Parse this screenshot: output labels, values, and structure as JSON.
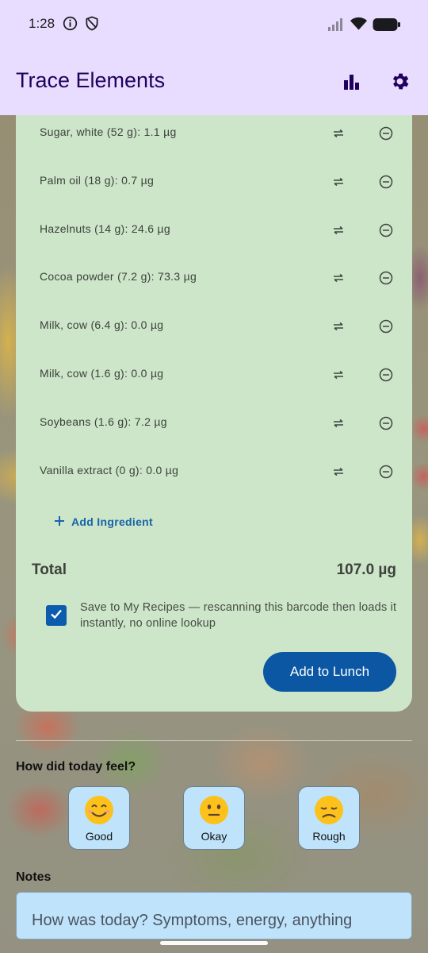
{
  "status_bar": {
    "time": "1:28"
  },
  "app_bar": {
    "title": "Trace Elements",
    "icons": [
      "bar-chart-icon",
      "settings-gear-icon"
    ]
  },
  "ingredients": [
    {
      "label": "Sugar, white (52 g): 1.1 µg"
    },
    {
      "label": "Palm oil (18 g): 0.7 µg"
    },
    {
      "label": "Hazelnuts (14 g): 24.6 µg"
    },
    {
      "label": "Cocoa powder (7.2 g): 73.3 µg"
    },
    {
      "label": "Milk, cow (6.4 g): 0.0 µg"
    },
    {
      "label": "Milk, cow (1.6 g): 0.0 µg"
    },
    {
      "label": "Soybeans (1.6 g): 7.2 µg"
    },
    {
      "label": "Vanilla extract (0 g): 0.0 µg"
    }
  ],
  "add_ingredient_label": "Add Ingredient",
  "total": {
    "label": "Total",
    "value": "107.0 µg"
  },
  "save_option": {
    "checked": true,
    "text": "Save to My Recipes — rescanning this barcode then loads it instantly, no online lookup"
  },
  "add_button_label": "Add to Lunch",
  "feel": {
    "title": "How did today feel?",
    "options": [
      {
        "label": "Good",
        "icon": "smiling-face-icon"
      },
      {
        "label": "Okay",
        "icon": "neutral-face-icon"
      },
      {
        "label": "Rough",
        "icon": "disappointed-face-icon"
      }
    ]
  },
  "notes": {
    "title": "Notes",
    "placeholder": "How was today? Symptoms, energy, anything"
  },
  "colors": {
    "app_bar_bg": "#e9ddff",
    "card_bg": "#cde5c9",
    "primary": "#0b57a4",
    "mood_bg": "#bfe3fa"
  }
}
